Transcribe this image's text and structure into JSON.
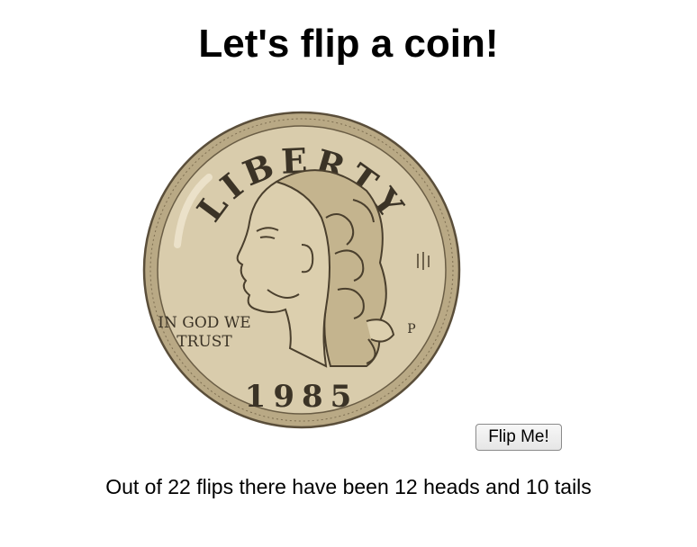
{
  "page": {
    "title": "Let's flip a coin!"
  },
  "coin": {
    "side": "heads",
    "inscription_top": "LIBERTY",
    "motto_line1": "IN GOD WE",
    "motto_line2": "TRUST",
    "year": "1985",
    "mint_mark": "P",
    "colors": {
      "face": "#d9ccac",
      "rim": "#b9a985",
      "outline": "#5a4e3a",
      "relief": "#c8b993"
    }
  },
  "controls": {
    "flip_label": "Flip Me!"
  },
  "stats": {
    "summary": "Out of 22 flips there have been 12 heads and 10 tails",
    "total_flips": 22,
    "heads": 12,
    "tails": 10
  }
}
